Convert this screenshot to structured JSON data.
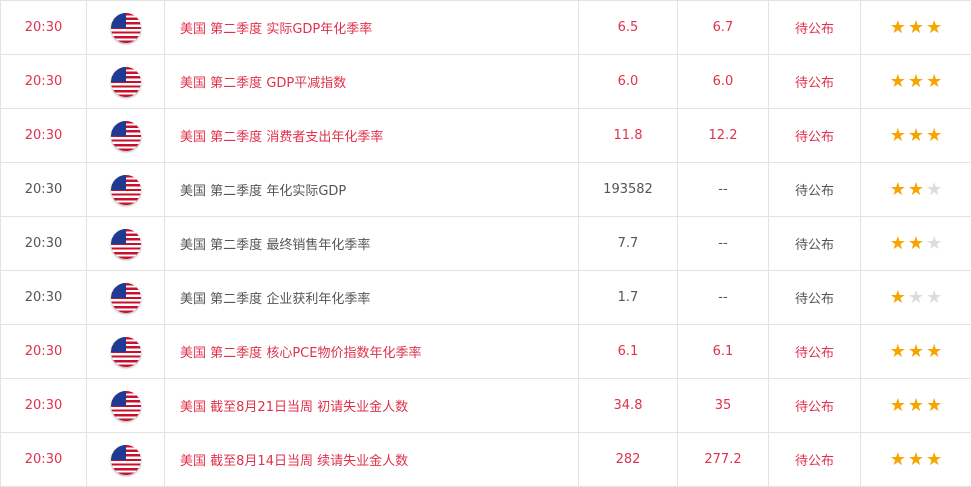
{
  "rows": [
    {
      "time": "20:30",
      "country": "美国",
      "period": "第二季度",
      "indicator": "实际GDP年化季率",
      "previous": "6.5",
      "forecast": "6.7",
      "actual": "待公布",
      "stars": 3,
      "highlight": true
    },
    {
      "time": "20:30",
      "country": "美国",
      "period": "第二季度",
      "indicator": "GDP平减指数",
      "previous": "6.0",
      "forecast": "6.0",
      "actual": "待公布",
      "stars": 3,
      "highlight": true
    },
    {
      "time": "20:30",
      "country": "美国",
      "period": "第二季度",
      "indicator": "消费者支出年化季率",
      "previous": "11.8",
      "forecast": "12.2",
      "actual": "待公布",
      "stars": 3,
      "highlight": true
    },
    {
      "time": "20:30",
      "country": "美国",
      "period": "第二季度",
      "indicator": "年化实际GDP",
      "previous": "193582",
      "forecast": "--",
      "actual": "待公布",
      "stars": 2,
      "highlight": false
    },
    {
      "time": "20:30",
      "country": "美国",
      "period": "第二季度",
      "indicator": "最终销售年化季率",
      "previous": "7.7",
      "forecast": "--",
      "actual": "待公布",
      "stars": 2,
      "highlight": false
    },
    {
      "time": "20:30",
      "country": "美国",
      "period": "第二季度",
      "indicator": "企业获利年化季率",
      "previous": "1.7",
      "forecast": "--",
      "actual": "待公布",
      "stars": 1,
      "highlight": false
    },
    {
      "time": "20:30",
      "country": "美国",
      "period": "第二季度",
      "indicator": "核心PCE物价指数年化季率",
      "previous": "6.1",
      "forecast": "6.1",
      "actual": "待公布",
      "stars": 3,
      "highlight": true
    },
    {
      "time": "20:30",
      "country": "美国",
      "period": "截至8月21日当周",
      "indicator": "初请失业金人数",
      "previous": "34.8",
      "forecast": "35",
      "actual": "待公布",
      "stars": 3,
      "highlight": true
    },
    {
      "time": "20:30",
      "country": "美国",
      "period": "截至8月14日当周",
      "indicator": "续请失业金人数",
      "previous": "282",
      "forecast": "277.2",
      "actual": "待公布",
      "stars": 3,
      "highlight": true
    }
  ],
  "colors": {
    "highlight_text": "#e0324b",
    "normal_text": "#555555",
    "star_on": "#f7a400",
    "star_off": "#dcdcdc"
  },
  "icons": {
    "flag": "us-flag-icon",
    "star": "star-icon"
  }
}
